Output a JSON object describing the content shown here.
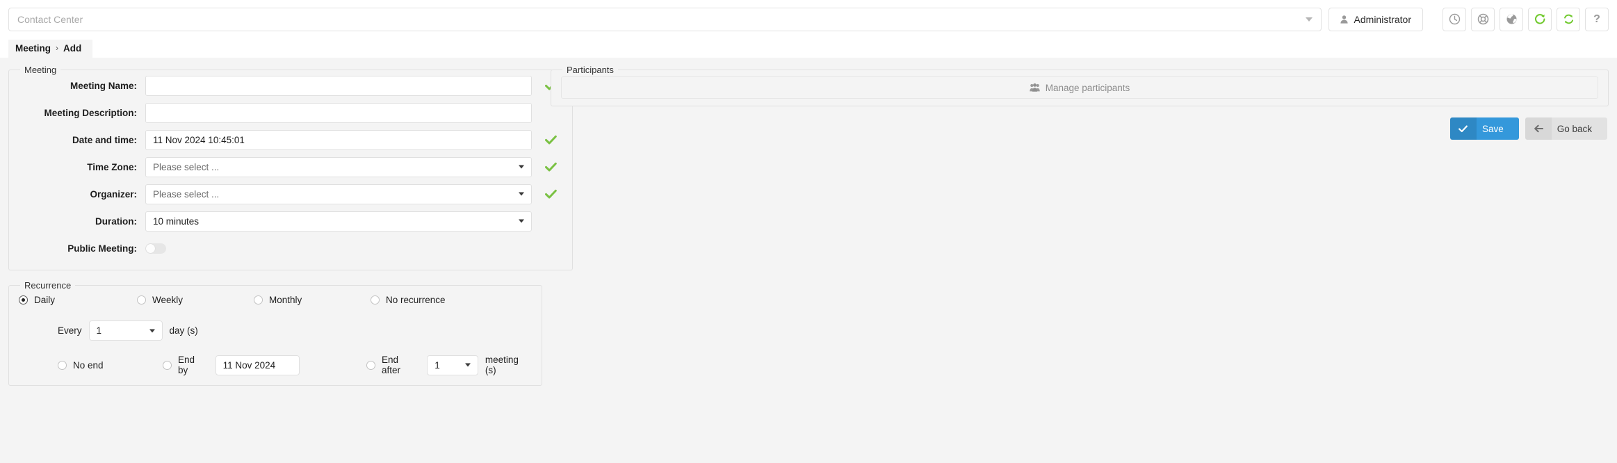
{
  "topbar": {
    "contact_center_placeholder": "Contact Center",
    "contact_center_value": "",
    "admin_label": "Administrator",
    "icons": [
      {
        "name": "clock-icon",
        "title": "Clock"
      },
      {
        "name": "lifebuoy-icon",
        "title": "Support"
      },
      {
        "name": "globe-icon",
        "title": "Language"
      },
      {
        "name": "reload-icon",
        "title": "Reload"
      },
      {
        "name": "sync-icon",
        "title": "Synchronize"
      }
    ],
    "help_label": "?"
  },
  "breadcrumb": {
    "root": "Meeting",
    "separator": "›",
    "current": "Add"
  },
  "meeting": {
    "legend": "Meeting",
    "fields": [
      {
        "label": "Meeting Name:",
        "value": "",
        "type": "text",
        "valid": true
      },
      {
        "label": "Meeting Description:",
        "value": "",
        "type": "text",
        "valid": false
      },
      {
        "label": "Date and time:",
        "value": "11 Nov 2024 10:45:01",
        "type": "text",
        "valid": true
      },
      {
        "label": "Time Zone:",
        "value": "Please select ...",
        "type": "select",
        "valid": true,
        "muted": true
      },
      {
        "label": "Organizer:",
        "value": "Please select ...",
        "type": "select",
        "valid": true,
        "muted": true
      },
      {
        "label": "Duration:",
        "value": "10 minutes",
        "type": "select",
        "valid": false
      }
    ],
    "public_meeting_label": "Public Meeting:",
    "public_meeting_on": false
  },
  "recurrence": {
    "legend": "Recurrence",
    "options": [
      {
        "label": "Daily",
        "selected": true
      },
      {
        "label": "Weekly",
        "selected": false
      },
      {
        "label": "Monthly",
        "selected": false
      },
      {
        "label": "No recurrence",
        "selected": false
      }
    ],
    "every_label": "Every",
    "every_value": "1",
    "every_unit": "day (s)",
    "end_options": [
      {
        "label": "No end",
        "selected": false
      },
      {
        "label": "End by",
        "selected": false
      },
      {
        "label": "End after",
        "selected": false
      }
    ],
    "end_by_date": "11 Nov 2024",
    "end_after_value": "1",
    "end_after_unit": "meeting (s)"
  },
  "participants": {
    "legend": "Participants",
    "manage_label": "Manage participants"
  },
  "actions": {
    "save_label": "Save",
    "go_back_label": "Go back"
  },
  "colors": {
    "accent_blue": "#3498db",
    "valid_green": "#7ac143",
    "page_bg": "#f4f4f4"
  }
}
